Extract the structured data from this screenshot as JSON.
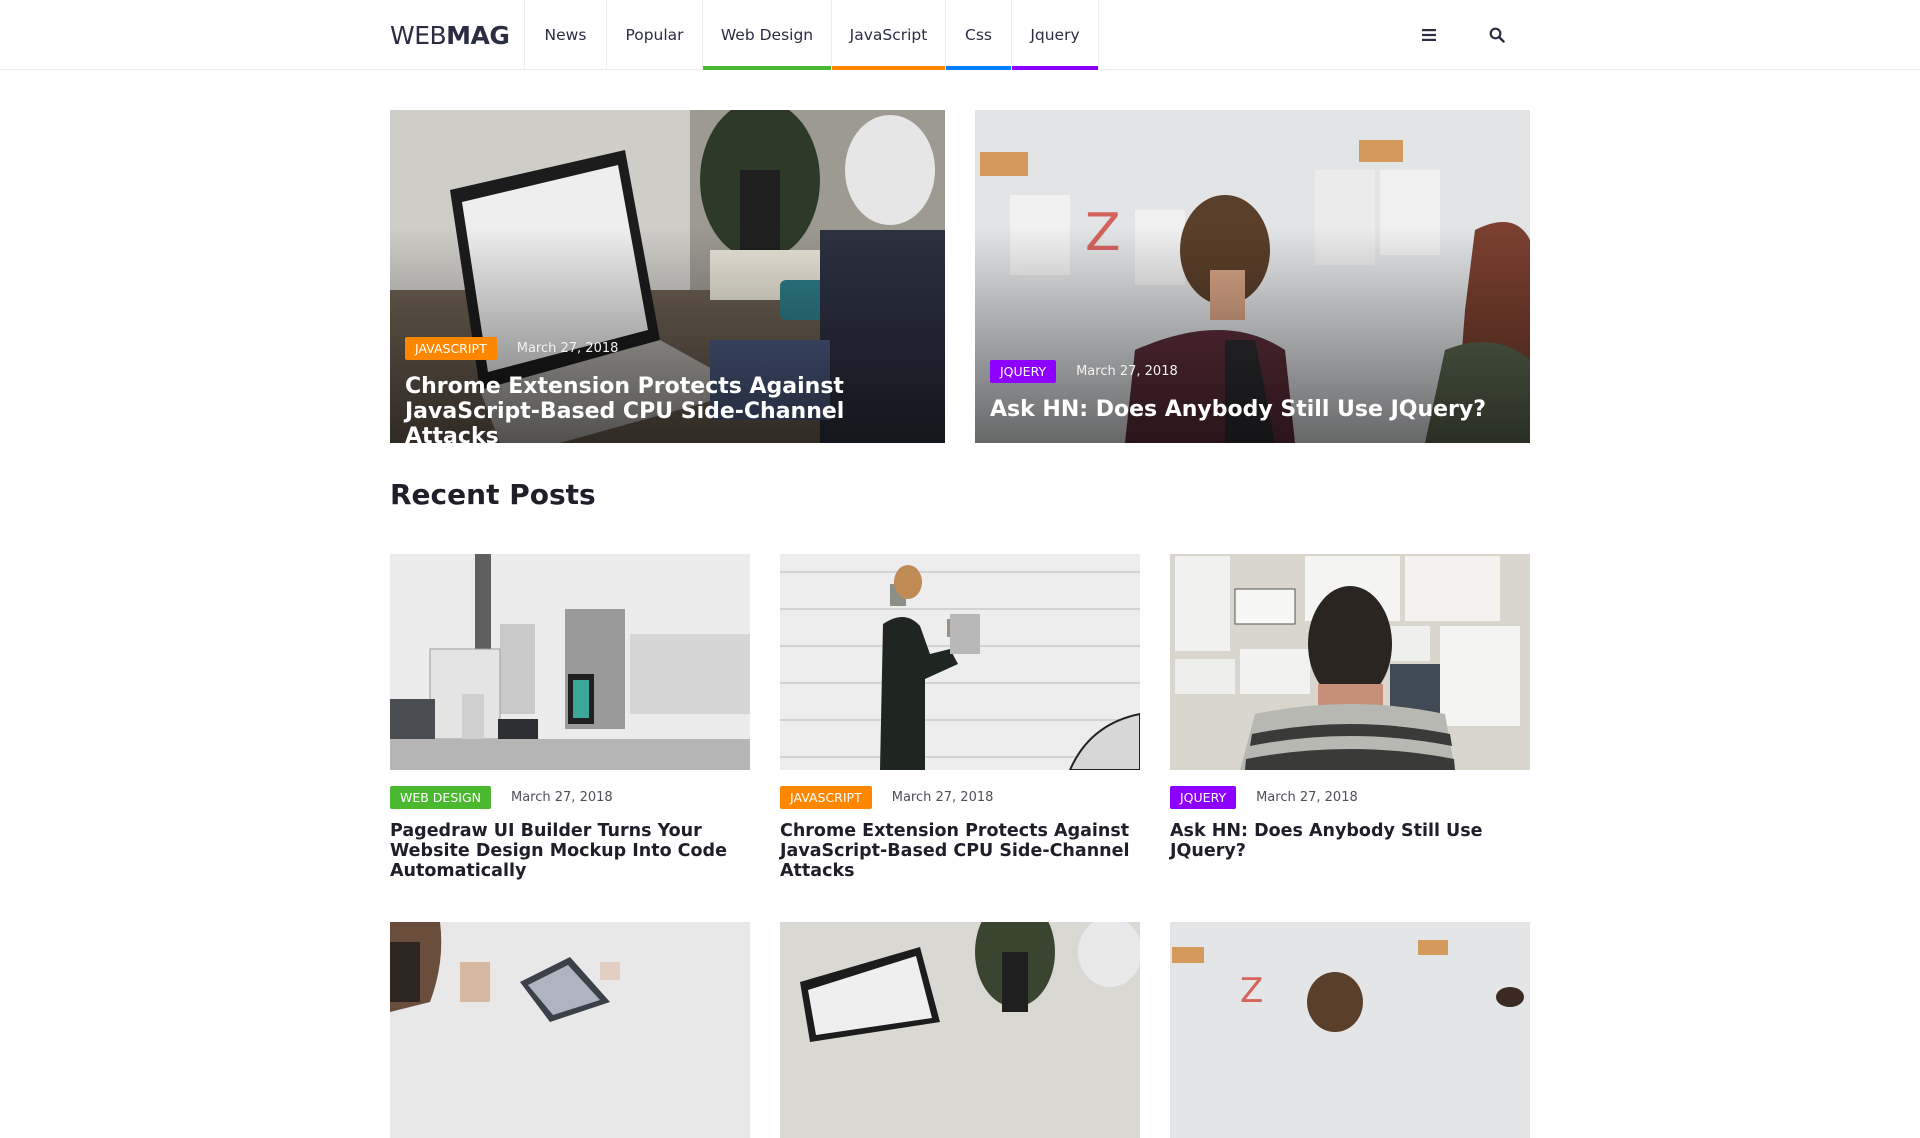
{
  "header": {
    "logo_thin": "WEB",
    "logo_bold": "MAG",
    "nav": [
      {
        "label": "News",
        "accent": null
      },
      {
        "label": "Popular",
        "accent": null
      },
      {
        "label": "Web Design",
        "accent": "#4bb92f"
      },
      {
        "label": "JavaScript",
        "accent": "#ff8700"
      },
      {
        "label": "Css",
        "accent": "#0080ff"
      },
      {
        "label": "Jquery",
        "accent": "#8d00ff"
      }
    ],
    "icons": {
      "menu": "menu-icon",
      "search": "search-icon"
    }
  },
  "colors": {
    "web_design": "#4bb92f",
    "javascript": "#ff8700",
    "css": "#0080ff",
    "jquery": "#8d00ff"
  },
  "featured": [
    {
      "category": "JAVASCRIPT",
      "date": "March 27, 2018",
      "title": "Chrome Extension Protects Against JavaScript-Based CPU Side-Channel Attacks"
    },
    {
      "category": "JQUERY",
      "date": "March 27, 2018",
      "title": "Ask HN: Does Anybody Still Use JQuery?"
    }
  ],
  "recent": {
    "heading": "Recent Posts",
    "posts": [
      {
        "category": "WEB DESIGN",
        "date": "March 27, 2018",
        "title": "Pagedraw UI Builder Turns Your Website Design Mockup Into Code Automatically"
      },
      {
        "category": "JAVASCRIPT",
        "date": "March 27, 2018",
        "title": "Chrome Extension Protects Against JavaScript-Based CPU Side-Channel Attacks"
      },
      {
        "category": "JQUERY",
        "date": "March 27, 2018",
        "title": "Ask HN: Does Anybody Still Use JQuery?"
      }
    ]
  }
}
